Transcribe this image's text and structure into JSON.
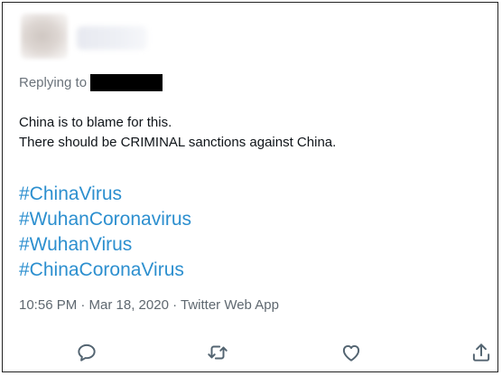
{
  "tweet": {
    "reply_prefix": "Replying to",
    "text_lines": [
      "China is to blame for this.",
      "There should be CRIMINAL sanctions against China."
    ],
    "hashtags": [
      "#ChinaVirus",
      "#WuhanCoronavirus",
      "#WuhanVirus",
      "#ChinaCoronaVirus"
    ],
    "meta": "10:56 PM · Mar 18, 2020 · Twitter Web App"
  },
  "actions": {
    "reply_icon": "reply-icon",
    "retweet_icon": "retweet-icon",
    "like_icon": "like-icon",
    "share_icon": "share-icon"
  },
  "colors": {
    "hashtag": "#2c8fcf",
    "text": "#0f1419",
    "secondary": "#6b737b",
    "icon": "#536471"
  }
}
